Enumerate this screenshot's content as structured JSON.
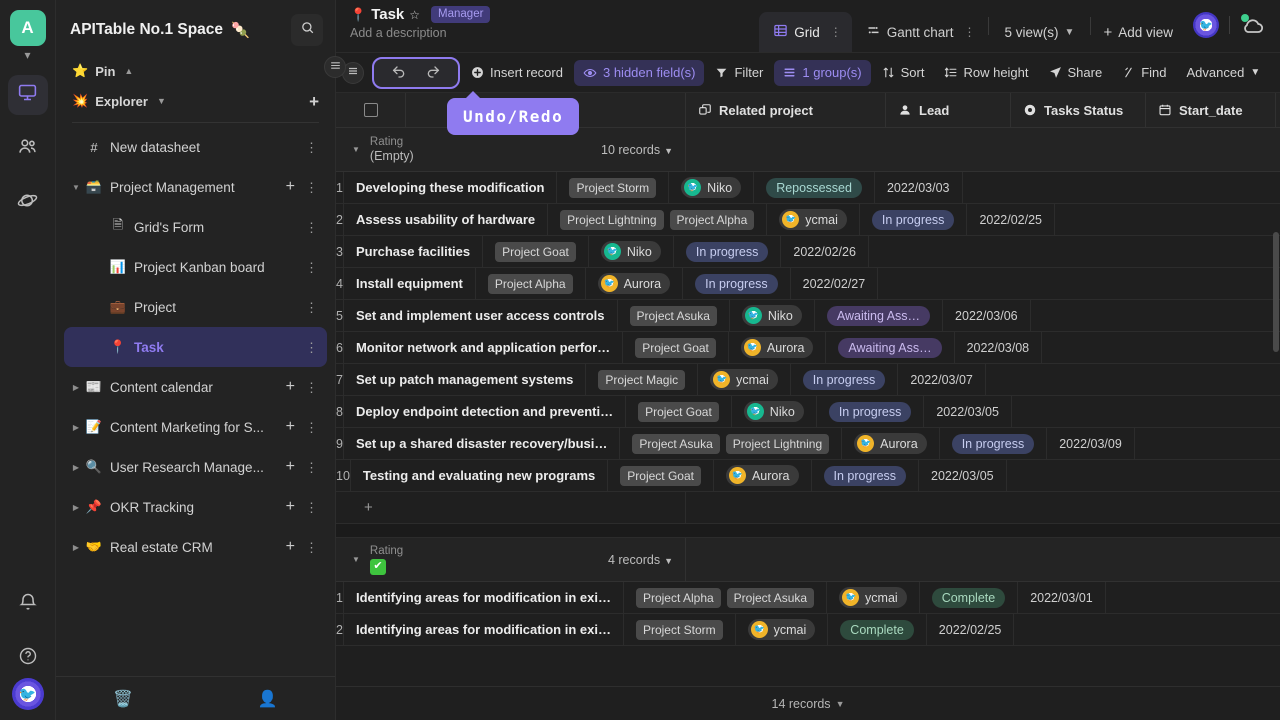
{
  "rail": {
    "space_avatar": "A",
    "items": [
      {
        "name": "workbench",
        "icon": "monitor-icon",
        "active": true
      },
      {
        "name": "members",
        "icon": "people-icon",
        "active": false
      },
      {
        "name": "templates",
        "icon": "planet-icon",
        "active": false
      }
    ],
    "bottom": [
      {
        "name": "notifications",
        "icon": "bell-icon"
      },
      {
        "name": "help",
        "icon": "question-icon"
      }
    ]
  },
  "sidebar": {
    "space_name": "APITable No.1 Space",
    "space_badge": "🍡",
    "search_icon": "search-icon",
    "pin": {
      "label": "Pin",
      "emoji": "⭐",
      "chevron": "⌃"
    },
    "explorer": {
      "label": "Explorer",
      "emoji": "💥",
      "chevron": "⌄",
      "add": "+"
    },
    "tree": [
      {
        "label": "New datasheet",
        "emoji": "#",
        "depth": 1,
        "expandable": false,
        "selected": false,
        "has_add": false
      },
      {
        "label": "Project Management",
        "emoji": "🗃️",
        "depth": 1,
        "expandable": true,
        "expanded": true,
        "selected": false,
        "has_add": true
      },
      {
        "label": "Grid's Form",
        "emoji": "🗎",
        "depth": 2,
        "expandable": false,
        "selected": false,
        "has_add": false
      },
      {
        "label": "Project Kanban board",
        "emoji": "📊",
        "depth": 2,
        "expandable": false,
        "selected": false,
        "has_add": false
      },
      {
        "label": "Project",
        "emoji": "💼",
        "depth": 2,
        "expandable": false,
        "selected": false,
        "has_add": false
      },
      {
        "label": "Task",
        "emoji": "📍",
        "depth": 2,
        "expandable": false,
        "selected": true,
        "has_add": false
      },
      {
        "label": "Content calendar",
        "emoji": "📰",
        "depth": 1,
        "expandable": true,
        "expanded": false,
        "selected": false,
        "has_add": true
      },
      {
        "label": "Content Marketing for S...",
        "emoji": "📝",
        "depth": 1,
        "expandable": true,
        "expanded": false,
        "selected": false,
        "has_add": true
      },
      {
        "label": "User Research Manage...",
        "emoji": "🔍",
        "depth": 1,
        "expandable": true,
        "expanded": false,
        "selected": false,
        "has_add": true
      },
      {
        "label": "OKR Tracking",
        "emoji": "📌",
        "depth": 1,
        "expandable": true,
        "expanded": false,
        "selected": false,
        "has_add": true
      },
      {
        "label": "Real estate CRM",
        "emoji": "🤝",
        "depth": 1,
        "expandable": true,
        "expanded": false,
        "selected": false,
        "has_add": true
      }
    ],
    "footer": [
      {
        "name": "trash",
        "icon": "trash-icon",
        "glyph": "🗑️"
      },
      {
        "name": "templates",
        "icon": "planet-icon",
        "glyph": "🪐"
      },
      {
        "name": "invite-member",
        "icon": "add-user-icon",
        "glyph": "👤"
      }
    ],
    "collapse_icon": "collapse-sidebar-icon"
  },
  "topbar": {
    "node_emoji": "📍",
    "node_title": "Task",
    "star_icon": "star-outline-icon",
    "role_badge": "Manager",
    "description_placeholder": "Add a description",
    "tabs": [
      {
        "label": "Grid",
        "icon": "grid-icon",
        "active": true
      },
      {
        "label": "Gantt chart",
        "icon": "gantt-icon",
        "active": false
      }
    ],
    "view_count": "5 view(s)",
    "add_view": "Add view",
    "cloud_icon": "cloud-sync-icon",
    "user_avatar_icon": "user-avatar"
  },
  "toolbar": {
    "collapse_icon": "collapse-icon",
    "undo_icon": "undo-icon",
    "redo_icon": "redo-icon",
    "items": [
      {
        "label": "Insert record",
        "icon": "plus-circle-icon",
        "accent": false
      },
      {
        "label": "3 hidden field(s)",
        "icon": "eye-icon",
        "accent": true
      },
      {
        "label": "Filter",
        "icon": "filter-icon",
        "accent": false
      },
      {
        "label": "1 group(s)",
        "icon": "group-icon",
        "accent": true
      },
      {
        "label": "Sort",
        "icon": "sort-icon",
        "accent": false
      },
      {
        "label": "Row height",
        "icon": "row-height-icon",
        "accent": false
      },
      {
        "label": "Share",
        "icon": "share-icon",
        "accent": false
      },
      {
        "label": "Find",
        "icon": "find-icon",
        "accent": false
      },
      {
        "label": "Advanced",
        "icon": "chevron-down-icon",
        "accent": false
      }
    ]
  },
  "tooltip": {
    "text": "Undo/Redo"
  },
  "grid": {
    "columns": [
      {
        "label": "",
        "icon": "checkbox-icon",
        "key": "cb"
      },
      {
        "label": "",
        "icon": "",
        "key": "num"
      },
      {
        "label": "",
        "icon": "",
        "key": "title"
      },
      {
        "label": "Related project",
        "icon": "link-icon",
        "key": "rel"
      },
      {
        "label": "Lead",
        "icon": "person-icon",
        "key": "lead"
      },
      {
        "label": "Tasks Status",
        "icon": "status-icon",
        "key": "stat"
      },
      {
        "label": "Start_date",
        "icon": "calendar-icon",
        "key": "date"
      }
    ],
    "groups": [
      {
        "field_label": "Rating",
        "value": "(Empty)",
        "value_is_check": false,
        "count": "10 records",
        "show_add_row": true,
        "rows": [
          {
            "num": "1",
            "title": "Developing these modification",
            "related": [
              "Project Storm"
            ],
            "lead": "Niko",
            "lead_color": "green",
            "status": "Repossessed",
            "status_class": "tag-repossessed",
            "date": "2022/03/03"
          },
          {
            "num": "2",
            "title": "Assess usability of hardware",
            "related": [
              "Project Lightning",
              "Project Alpha"
            ],
            "lead": "ycmai",
            "lead_color": "orange",
            "status": "In progress",
            "status_class": "tag-inprogress",
            "date": "2022/02/25"
          },
          {
            "num": "3",
            "title": "Purchase facilities",
            "related": [
              "Project Goat"
            ],
            "lead": "Niko",
            "lead_color": "green",
            "status": "In progress",
            "status_class": "tag-inprogress",
            "date": "2022/02/26"
          },
          {
            "num": "4",
            "title": "Install equipment",
            "related": [
              "Project Alpha"
            ],
            "lead": "Aurora",
            "lead_color": "orange",
            "status": "In progress",
            "status_class": "tag-inprogress",
            "date": "2022/02/27"
          },
          {
            "num": "5",
            "title": "Set and implement user access controls",
            "related": [
              "Project Asuka"
            ],
            "lead": "Niko",
            "lead_color": "green",
            "status": "Awaiting Ass…",
            "status_class": "tag-awaiting",
            "date": "2022/03/06"
          },
          {
            "num": "6",
            "title": "Monitor network and application perfor…",
            "related": [
              "Project Goat"
            ],
            "lead": "Aurora",
            "lead_color": "orange",
            "status": "Awaiting Ass…",
            "status_class": "tag-awaiting",
            "date": "2022/03/08"
          },
          {
            "num": "7",
            "title": "Set up patch management systems",
            "related": [
              "Project Magic"
            ],
            "lead": "ycmai",
            "lead_color": "orange",
            "status": "In progress",
            "status_class": "tag-inprogress",
            "date": "2022/03/07"
          },
          {
            "num": "8",
            "title": "Deploy endpoint detection and preventi…",
            "related": [
              "Project Goat"
            ],
            "lead": "Niko",
            "lead_color": "green",
            "status": "In progress",
            "status_class": "tag-inprogress",
            "date": "2022/03/05"
          },
          {
            "num": "9",
            "title": "Set up a shared disaster recovery/busi…",
            "related": [
              "Project Asuka",
              "Project Lightning"
            ],
            "lead": "Aurora",
            "lead_color": "orange",
            "status": "In progress",
            "status_class": "tag-inprogress",
            "date": "2022/03/09"
          },
          {
            "num": "10",
            "title": "Testing and evaluating new programs",
            "related": [
              "Project Goat"
            ],
            "lead": "Aurora",
            "lead_color": "orange",
            "status": "In progress",
            "status_class": "tag-inprogress",
            "date": "2022/03/05"
          }
        ]
      },
      {
        "field_label": "Rating",
        "value": "✅",
        "value_is_check": true,
        "count": "4 records",
        "show_add_row": false,
        "rows": [
          {
            "num": "1",
            "title": "Identifying areas for modification in exi…",
            "related": [
              "Project Alpha",
              "Project Asuka"
            ],
            "lead": "ycmai",
            "lead_color": "orange",
            "status": "Complete",
            "status_class": "tag-complete",
            "date": "2022/03/01"
          },
          {
            "num": "2",
            "title": "Identifying areas for modification in exi…",
            "related": [
              "Project Storm"
            ],
            "lead": "ycmai",
            "lead_color": "orange",
            "status": "Complete",
            "status_class": "tag-complete",
            "date": "2022/02/25"
          }
        ]
      }
    ]
  },
  "statusbar": {
    "record_count": "14 records"
  }
}
